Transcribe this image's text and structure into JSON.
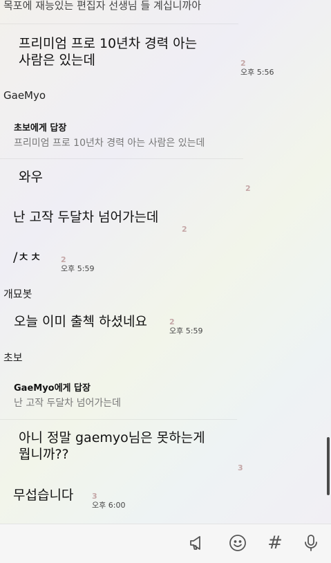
{
  "messages": {
    "m0_text": "목포에 재능있는 편집자 선생님 들 계십니까아",
    "m1_text": "프리미엄 프로 10년차 경력 아는\n사람은 있는데",
    "m1_count": "2",
    "m1_time": "오후 5:56",
    "sender_gaemyo": "GaeMyo",
    "reply1_title": "초보에게 답장",
    "reply1_text": "프리미엄 프로 10년차 경력 아는 사람은 있는데",
    "m2_text": "와우",
    "m2_count": "2",
    "m3_text": "난 고작 두달차 넘어가는데",
    "m3_count": "2",
    "m4_text": "/ㅊㅊ",
    "m4_count": "2",
    "m4_time": "오후 5:59",
    "sender_bot": "개묘봇",
    "m5_text": "오늘 이미 출첵 하셨네요",
    "m5_count": "2",
    "m5_time": "오후 5:59",
    "sender_chobo": "초보",
    "reply2_title": "GaeMyo에게 답장",
    "reply2_text": "난 고작 두달차 넘어가는데",
    "m6_text": "아니 정말 gaemyo님은 못하는게\n뭡니까??",
    "m6_count": "3",
    "m7_text": "무섭습니다",
    "m7_count": "3",
    "m7_time": "오후 6:00"
  },
  "toolbar": {
    "icons": [
      "megaphone-icon",
      "emoji-icon",
      "hashtag-icon",
      "microphone-icon"
    ],
    "hashtag_glyph": "#"
  }
}
